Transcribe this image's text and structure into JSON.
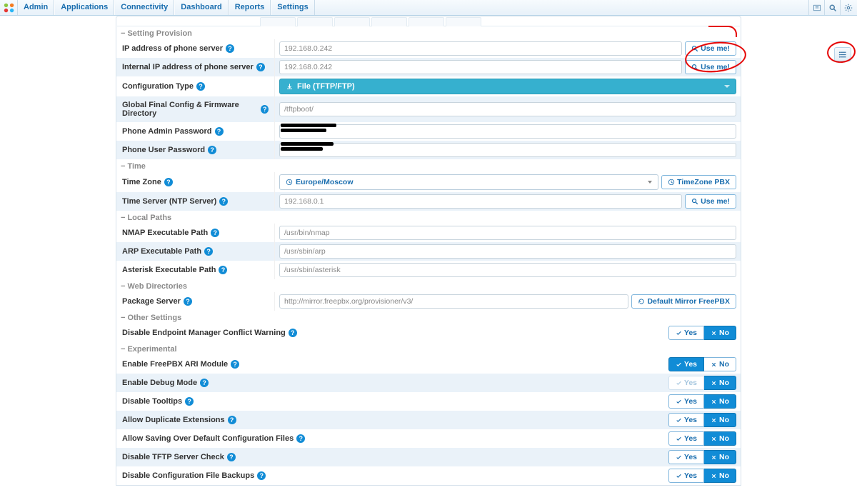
{
  "nav": {
    "items": [
      "Admin",
      "Applications",
      "Connectivity",
      "Dashboard",
      "Reports",
      "Settings"
    ]
  },
  "labels": {
    "useMe": "Use me!",
    "tzPBX": "TimeZone PBX",
    "defaultMirror": "Default Mirror FreePBX",
    "yes": "Yes",
    "no": "No"
  },
  "sections": {
    "setting": {
      "title": "Setting Provision"
    },
    "time": {
      "title": "Time"
    },
    "local": {
      "title": "Local Paths"
    },
    "web": {
      "title": "Web Directories"
    },
    "other": {
      "title": "Other Settings"
    },
    "exp": {
      "title": "Experimental"
    }
  },
  "fields": {
    "ipPhone": {
      "label": "IP address of phone server",
      "value": "192.168.0.242"
    },
    "ipInternal": {
      "label": "Internal IP address of phone server",
      "value": "192.168.0.242"
    },
    "cfgType": {
      "label": "Configuration Type",
      "value": "File (TFTP/FTP)"
    },
    "globalDir": {
      "label": "Global Final Config & Firmware Directory",
      "value": "/tftpboot/"
    },
    "adminPw": {
      "label": "Phone Admin Password"
    },
    "userPw": {
      "label": "Phone User Password"
    },
    "tz": {
      "label": "Time Zone",
      "value": "Europe/Moscow"
    },
    "ntp": {
      "label": "Time Server (NTP Server)",
      "value": "192.168.0.1"
    },
    "nmap": {
      "label": "NMAP Executable Path",
      "value": "/usr/bin/nmap"
    },
    "arp": {
      "label": "ARP Executable Path",
      "value": "/usr/sbin/arp"
    },
    "asterisk": {
      "label": "Asterisk Executable Path",
      "value": "/usr/sbin/asterisk"
    },
    "pkg": {
      "label": "Package Server",
      "value": "http://mirror.freepbx.org/provisioner/v3/"
    },
    "conflict": {
      "label": "Disable Endpoint Manager Conflict Warning"
    },
    "ari": {
      "label": "Enable FreePBX ARI Module"
    },
    "debug": {
      "label": "Enable Debug Mode"
    },
    "tooltips": {
      "label": "Disable Tooltips"
    },
    "dupext": {
      "label": "Allow Duplicate Extensions"
    },
    "saveover": {
      "label": "Allow Saving Over Default Configuration Files"
    },
    "tftpchk": {
      "label": "Disable TFTP Server Check"
    },
    "cfgbak": {
      "label": "Disable Configuration File Backups"
    }
  }
}
